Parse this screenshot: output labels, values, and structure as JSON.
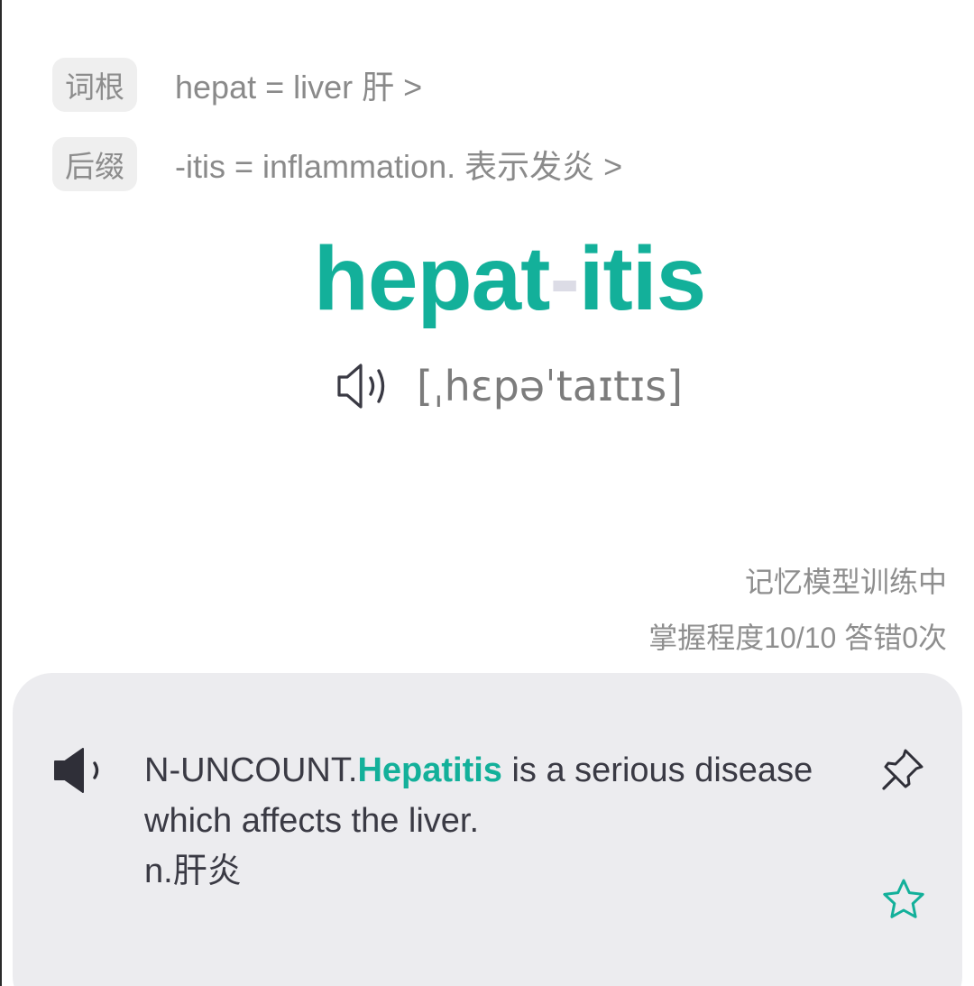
{
  "morphemes": [
    {
      "tag": "词根",
      "text": "hepat = liver 肝 >"
    },
    {
      "tag": "后缀",
      "text": "-itis = inflammation. 表示发炎 >"
    }
  ],
  "word": {
    "root": "hepat",
    "separator": "-",
    "suffix": "itis",
    "phonetic": "[ˌhɛpəˈtaɪtɪs]",
    "speaker_icon": "speaker-outline-icon"
  },
  "training": {
    "status": "记忆模型训练中",
    "progress_text": "掌握程度10/10  答错0次"
  },
  "definition": {
    "pos_prefix": "N-UNCOUNT.",
    "keyword": "Hepatitis",
    "rest": " is a serious disease which affects the liver.",
    "translation": "n.肝炎",
    "speaker_icon": "speaker-filled-icon",
    "pin_icon": "pin-icon",
    "star_icon": "star-outline-icon"
  },
  "colors": {
    "accent": "#13b09a",
    "separator": "#dcdce6",
    "card_bg": "#ececef",
    "tag_bg": "#efefef",
    "muted_text": "#8a8a8a",
    "body_text": "#3a3a44"
  }
}
